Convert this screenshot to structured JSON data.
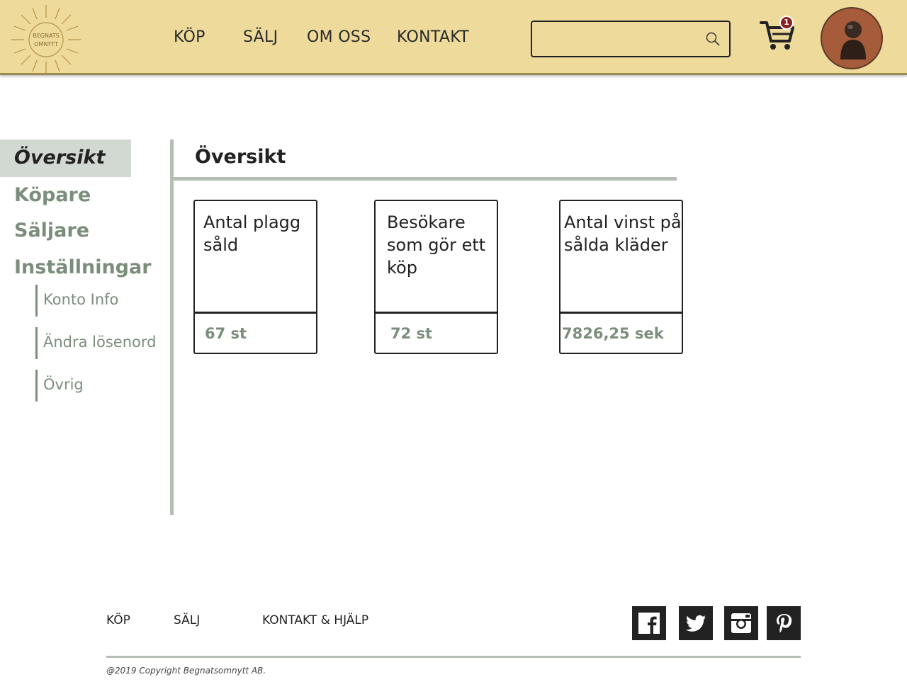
{
  "brand": {
    "logo_line1": "BEGNATS",
    "logo_line2": "OMNYTT"
  },
  "nav": {
    "items": [
      "KÖP",
      "SÄLJ",
      "OM OSS",
      "KONTAKT"
    ]
  },
  "search": {
    "value": "",
    "placeholder": ""
  },
  "cart": {
    "count": "1"
  },
  "colors": {
    "header_bg": "#eeda9a",
    "accent_green": "#7b8e7c",
    "active_bg": "#d2d8d2",
    "badge": "#8b1e1e",
    "avatar_bg": "#a65b3a"
  },
  "sidebar": {
    "items": [
      {
        "label": "Översikt",
        "active": true
      },
      {
        "label": "Köpare"
      },
      {
        "label": "Säljare"
      },
      {
        "label": "Inställningar"
      }
    ],
    "sub_items": [
      "Konto Info",
      "Ändra lösenord",
      "Övrig"
    ]
  },
  "main": {
    "title": "Översikt",
    "cards": [
      {
        "label": "Antal plagg såld",
        "value": "67 st"
      },
      {
        "label": "Besökare som gör ett köp",
        "value": "72 st"
      },
      {
        "label": "Antal vinst på sålda kläder",
        "value": "7826,25 sek"
      }
    ]
  },
  "footer": {
    "links": [
      "KÖP",
      "SÄLJ",
      "KONTAKT & HJÄLP"
    ],
    "social": [
      "facebook-icon",
      "twitter-icon",
      "instagram-icon",
      "pinterest-icon"
    ],
    "copyright": "@2019 Copyright Begnatsomnytt AB."
  }
}
